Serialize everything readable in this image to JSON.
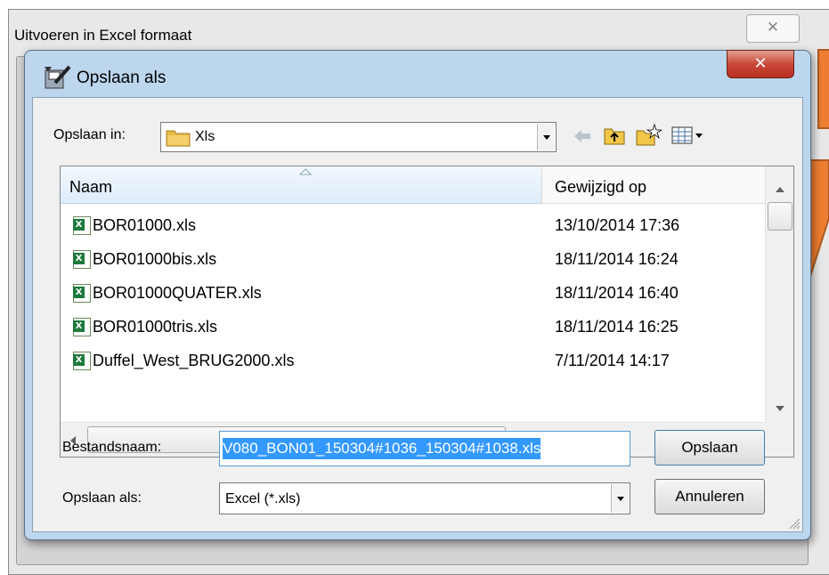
{
  "outer_window": {
    "title": "Uitvoeren in Excel formaat",
    "close_glyph": "✕"
  },
  "dialog": {
    "title": "Opslaan als",
    "close_glyph": "✕",
    "save_in_label": "Opslaan in:",
    "save_in_value": "Xls",
    "toolbar_icons": [
      "back-arrow-icon",
      "up-folder-icon",
      "new-folder-icon",
      "view-menu-icon"
    ],
    "columns": {
      "name": "Naam",
      "modified": "Gewijzigd op"
    },
    "files": [
      {
        "name": "BOR01000.xls",
        "modified": "13/10/2014 17:36"
      },
      {
        "name": "BOR01000bis.xls",
        "modified": "18/11/2014 16:24"
      },
      {
        "name": "BOR01000QUATER.xls",
        "modified": "18/11/2014 16:40"
      },
      {
        "name": "BOR01000tris.xls",
        "modified": "18/11/2014 16:25"
      },
      {
        "name": "Duffel_West_BRUG2000.xls",
        "modified": "7/11/2014 14:17"
      }
    ],
    "filename_label": "Bestandsnaam:",
    "filename_value": "V080_BON01_150304#1036_150304#1038.xls",
    "filetype_label": "Opslaan als:",
    "filetype_value": "Excel (*.xls)",
    "save_button": "Opslaan",
    "cancel_button": "Annuleren",
    "hscroll_grip": "III"
  },
  "colors": {
    "callout": "#ed7d31",
    "selection": "#3399ff",
    "excel_icon": "#1d7a3b"
  }
}
